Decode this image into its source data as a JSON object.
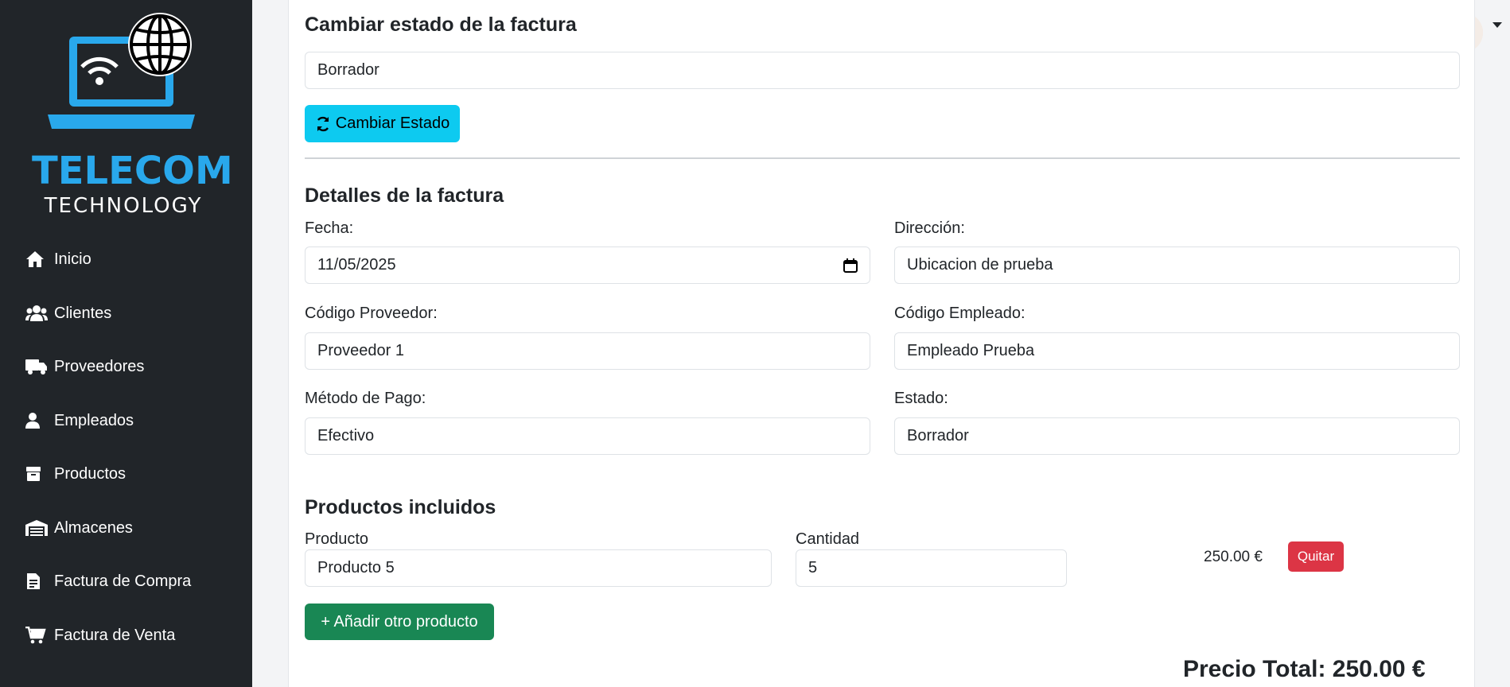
{
  "brand": {
    "name": "TELECOM",
    "subtitle": "TECHNOLOGY"
  },
  "sidebar": {
    "items": [
      {
        "label": "Inicio",
        "icon": "home-icon"
      },
      {
        "label": "Clientes",
        "icon": "users-icon"
      },
      {
        "label": "Proveedores",
        "icon": "truck-icon"
      },
      {
        "label": "Empleados",
        "icon": "user-icon"
      },
      {
        "label": "Productos",
        "icon": "box-icon"
      },
      {
        "label": "Almacenes",
        "icon": "warehouse-icon"
      },
      {
        "label": "Factura de Compra",
        "icon": "file-invoice-icon"
      },
      {
        "label": "Factura de Venta",
        "icon": "cart-icon"
      }
    ]
  },
  "status_section": {
    "title": "Cambiar estado de la factura",
    "current_status": "Borrador",
    "button_label": "Cambiar Estado"
  },
  "details": {
    "title": "Detalles de la factura",
    "fecha_label": "Fecha:",
    "fecha_value": "11/05/2025",
    "direccion_label": "Dirección:",
    "direccion_value": "Ubicacion de prueba",
    "proveedor_label": "Código Proveedor:",
    "proveedor_value": "Proveedor 1",
    "empleado_label": "Código Empleado:",
    "empleado_value": "Empleado Prueba",
    "metodo_label": "Método de Pago:",
    "metodo_value": "Efectivo",
    "estado_label": "Estado:",
    "estado_value": "Borrador"
  },
  "products": {
    "title": "Productos incluidos",
    "producto_header": "Producto",
    "cantidad_header": "Cantidad",
    "rows": [
      {
        "producto": "Producto 5",
        "cantidad": "5",
        "subtotal": "250.00 €",
        "remove_label": "Quitar"
      }
    ],
    "add_label": "+ Añadir otro producto"
  },
  "total": {
    "label": "Precio Total: 250.00 €"
  },
  "colors": {
    "sidebar": "#212529",
    "info": "#0dcaf0",
    "success": "#198754",
    "danger": "#dc3545",
    "brand_blue": "#29a8ec"
  }
}
